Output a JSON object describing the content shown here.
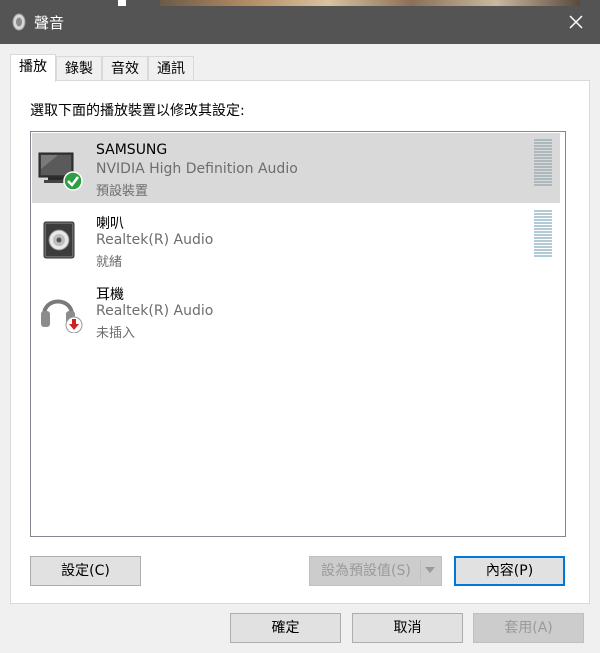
{
  "window": {
    "title": "聲音"
  },
  "tabs": [
    {
      "label": "播放"
    },
    {
      "label": "錄製"
    },
    {
      "label": "音效"
    },
    {
      "label": "通訊"
    }
  ],
  "instruction": "選取下面的播放裝置以修改其設定:",
  "devices": [
    {
      "name": "SAMSUNG",
      "driver": "NVIDIA High Definition Audio",
      "status": "預設裝置",
      "icon": "monitor-icon",
      "selected": true
    },
    {
      "name": "喇叭",
      "driver": "Realtek(R) Audio",
      "status": "就緒",
      "icon": "speaker-icon",
      "selected": false
    },
    {
      "name": "耳機",
      "driver": "Realtek(R) Audio",
      "status": "未插入",
      "icon": "headphones-icon",
      "selected": false
    }
  ],
  "buttons": {
    "configure": "設定(C)",
    "set_default": "設為預設值(S)",
    "properties": "內容(P)",
    "ok": "確定",
    "cancel": "取消",
    "apply": "套用(A)"
  },
  "colors": {
    "accent": "#0078d7",
    "default_check": "#2e9e45",
    "unplugged": "#cc2222"
  }
}
